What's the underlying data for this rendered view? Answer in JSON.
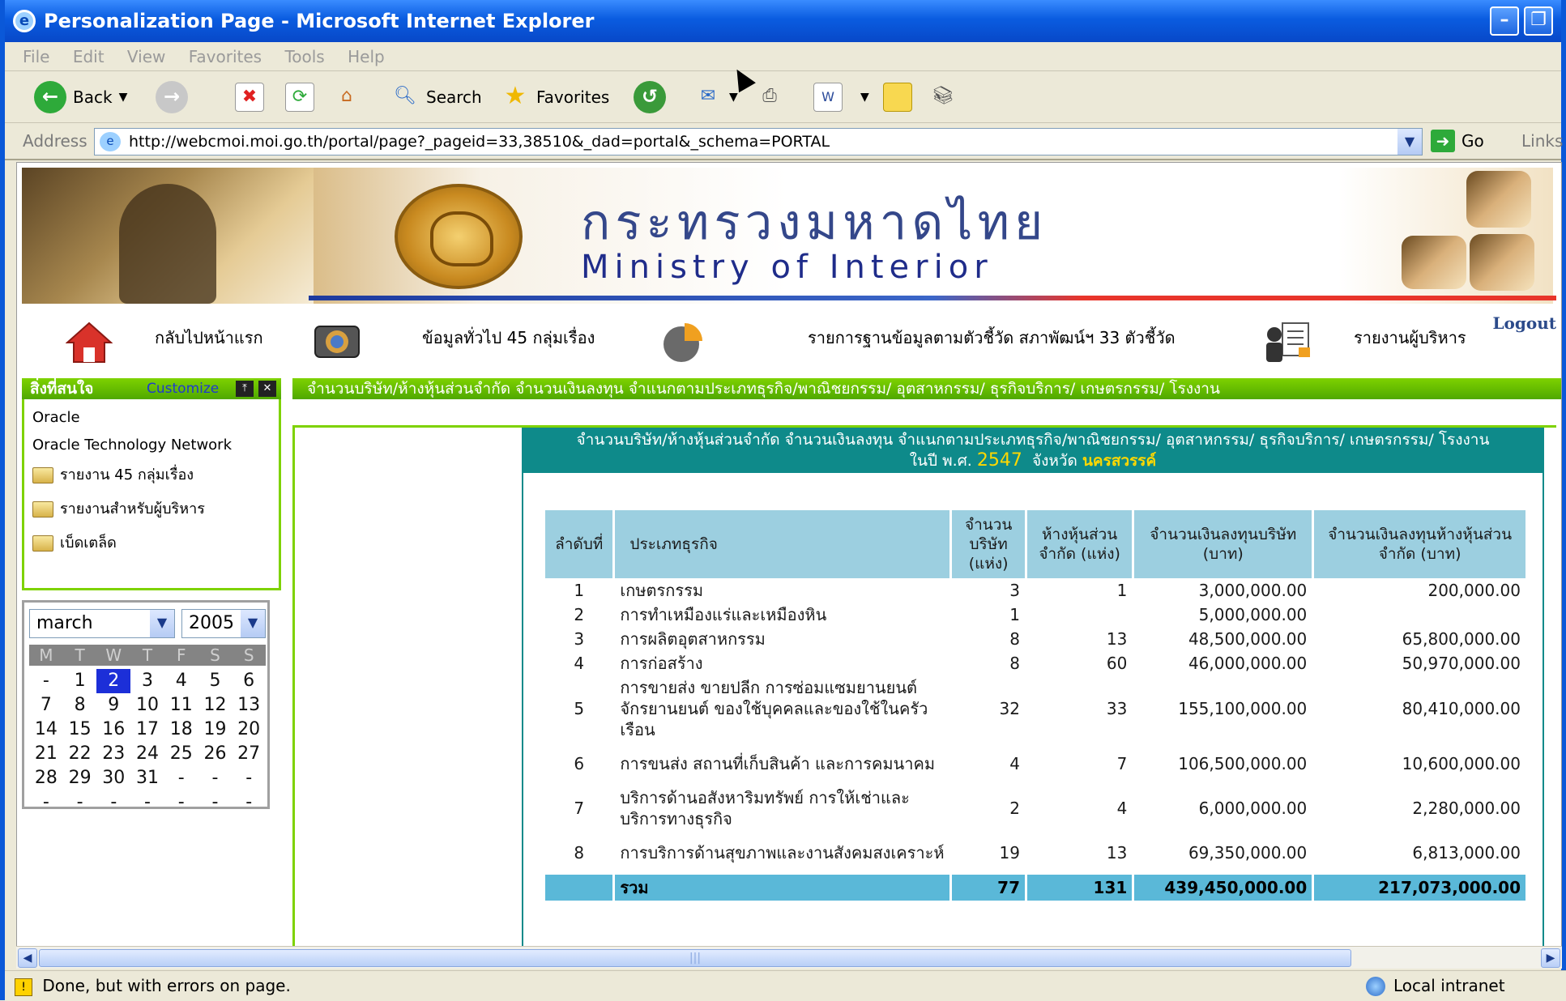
{
  "window": {
    "title": "Personalization Page - Microsoft Internet Explorer"
  },
  "menu": [
    "File",
    "Edit",
    "View",
    "Favorites",
    "Tools",
    "Help"
  ],
  "toolbar": {
    "back_label": "Back",
    "search_label": "Search",
    "favorites_label": "Favorites"
  },
  "address": {
    "label": "Address",
    "url": "http://webcmoi.moi.go.th/portal/page?_pageid=33,38510&_dad=portal&_schema=PORTAL",
    "go_label": "Go",
    "links_label": "Links"
  },
  "banner": {
    "title_th": "กระทรวงมหาดไทย",
    "title_en": "Ministry of Interior"
  },
  "nav": {
    "home_label": "กลับไปหน้าแรก",
    "general_label": "ข้อมูลทั่วไป 45 กลุ่มเรื่อง",
    "indicators_label": "รายการฐานข้อมูลตามตัวชี้วัด สภาพัฒน์ฯ 33 ตัวชี้วัด",
    "executive_label": "รายงานผู้บริหาร",
    "logout_label": "Logout"
  },
  "sidebar": {
    "title": "สิ่งที่สนใจ",
    "customize_label": "Customize",
    "items": [
      "Oracle",
      "Oracle Technology Network",
      "รายงาน 45 กลุ่มเรื่อง",
      "รายงานสำหรับผู้บริหาร",
      "เบ็ดเตล็ด"
    ]
  },
  "calendar": {
    "month": "march",
    "year": "2005",
    "weekdays": [
      "M",
      "T",
      "W",
      "T",
      "F",
      "S",
      "S"
    ],
    "weeks": [
      [
        "-",
        "1",
        "2",
        "3",
        "4",
        "5",
        "6"
      ],
      [
        "7",
        "8",
        "9",
        "10",
        "11",
        "12",
        "13"
      ],
      [
        "14",
        "15",
        "16",
        "17",
        "18",
        "19",
        "20"
      ],
      [
        "21",
        "22",
        "23",
        "24",
        "25",
        "26",
        "27"
      ],
      [
        "28",
        "29",
        "30",
        "31",
        "-",
        "-",
        "-"
      ],
      [
        "-",
        "-",
        "-",
        "-",
        "-",
        "-",
        "-"
      ]
    ],
    "selected": "2"
  },
  "main": {
    "portlet_title": "จำนวนบริษัท/ห้างหุ้นส่วนจำกัด จำนวนเงินลงทุน จำแนกตามประเภทธุรกิจ/พาณิชยกรรม/ อุตสาหกรรม/ ธุรกิจบริการ/ เกษตรกรรม/ โรงงาน",
    "report_title": "จำนวนบริษัท/ห้างหุ้นส่วนจำกัด จำนวนเงินลงทุน จำแนกตามประเภทธุรกิจ/พาณิชยกรรม/ อุตสาหกรรม/ ธุรกิจบริการ/ เกษตรกรรม/ โรงงาน",
    "year_prefix": "ในปี พ.ศ.",
    "year": "2547",
    "province_prefix": "จังหวัด",
    "province": "นครสวรรค์"
  },
  "table": {
    "headers": [
      "ลำดับที่",
      "ประเภทธุรกิจ",
      "จำนวน บริษัท (แห่ง)",
      "ห้างหุ้นส่วน จำกัด (แห่ง)",
      "จำนวนเงินลงทุนบริษัท (บาท)",
      "จำนวนเงินลงทุนห้างหุ้นส่วน จำกัด (บาท)"
    ],
    "rows": [
      [
        "1",
        "เกษตรกรรม",
        "3",
        "1",
        "3,000,000.00",
        "200,000.00"
      ],
      [
        "2",
        "การทำเหมืองแร่และเหมืองหิน",
        "1",
        "",
        "5,000,000.00",
        ""
      ],
      [
        "3",
        "การผลิตอุตสาหกรรม",
        "8",
        "13",
        "48,500,000.00",
        "65,800,000.00"
      ],
      [
        "4",
        "การก่อสร้าง",
        "8",
        "60",
        "46,000,000.00",
        "50,970,000.00"
      ],
      [
        "5",
        "การขายส่ง ขายปลีก การซ่อมแซมยานยนต์ จักรยานยนต์ ของใช้บุคคลและของใช้ในครัวเรือน",
        "32",
        "33",
        "155,100,000.00",
        "80,410,000.00"
      ],
      [
        "6",
        "การขนส่ง สถานที่เก็บสินค้า และการคมนาคม",
        "4",
        "7",
        "106,500,000.00",
        "10,600,000.00"
      ],
      [
        "7",
        "บริการด้านอสังหาริมทรัพย์ การให้เช่าและบริการทางธุรกิจ",
        "2",
        "4",
        "6,000,000.00",
        "2,280,000.00"
      ],
      [
        "8",
        "การบริการด้านสุขภาพและงานสังคมสงเคราะห์",
        "19",
        "13",
        "69,350,000.00",
        "6,813,000.00"
      ]
    ],
    "total": [
      "",
      "รวม",
      "77",
      "131",
      "439,450,000.00",
      "217,073,000.00"
    ]
  },
  "status": {
    "text": "Done, but with errors on page.",
    "zone": "Local intranet"
  }
}
